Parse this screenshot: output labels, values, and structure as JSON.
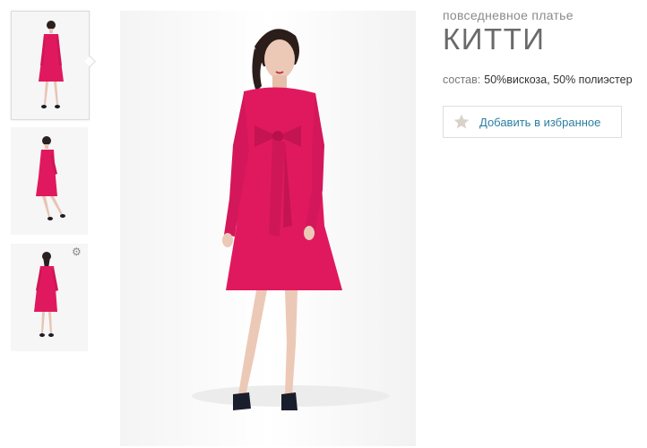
{
  "gallery": {
    "thumbnails": [
      {
        "view": "front",
        "active": true
      },
      {
        "view": "side",
        "active": false
      },
      {
        "view": "back",
        "active": false
      }
    ],
    "overlay_icon": "gear-icon"
  },
  "product": {
    "subtitle": "повседневное платье",
    "name": "КИТТИ",
    "composition_label": "состав:",
    "composition_value": "50%вискоза, 50% полиэстер",
    "favorite_label": "Добавить в избранное",
    "favorite_icon": "star-icon"
  },
  "colors": {
    "dress": "#e0195e",
    "accent_link": "#2a7fa0",
    "star": "#d9d2cb"
  }
}
